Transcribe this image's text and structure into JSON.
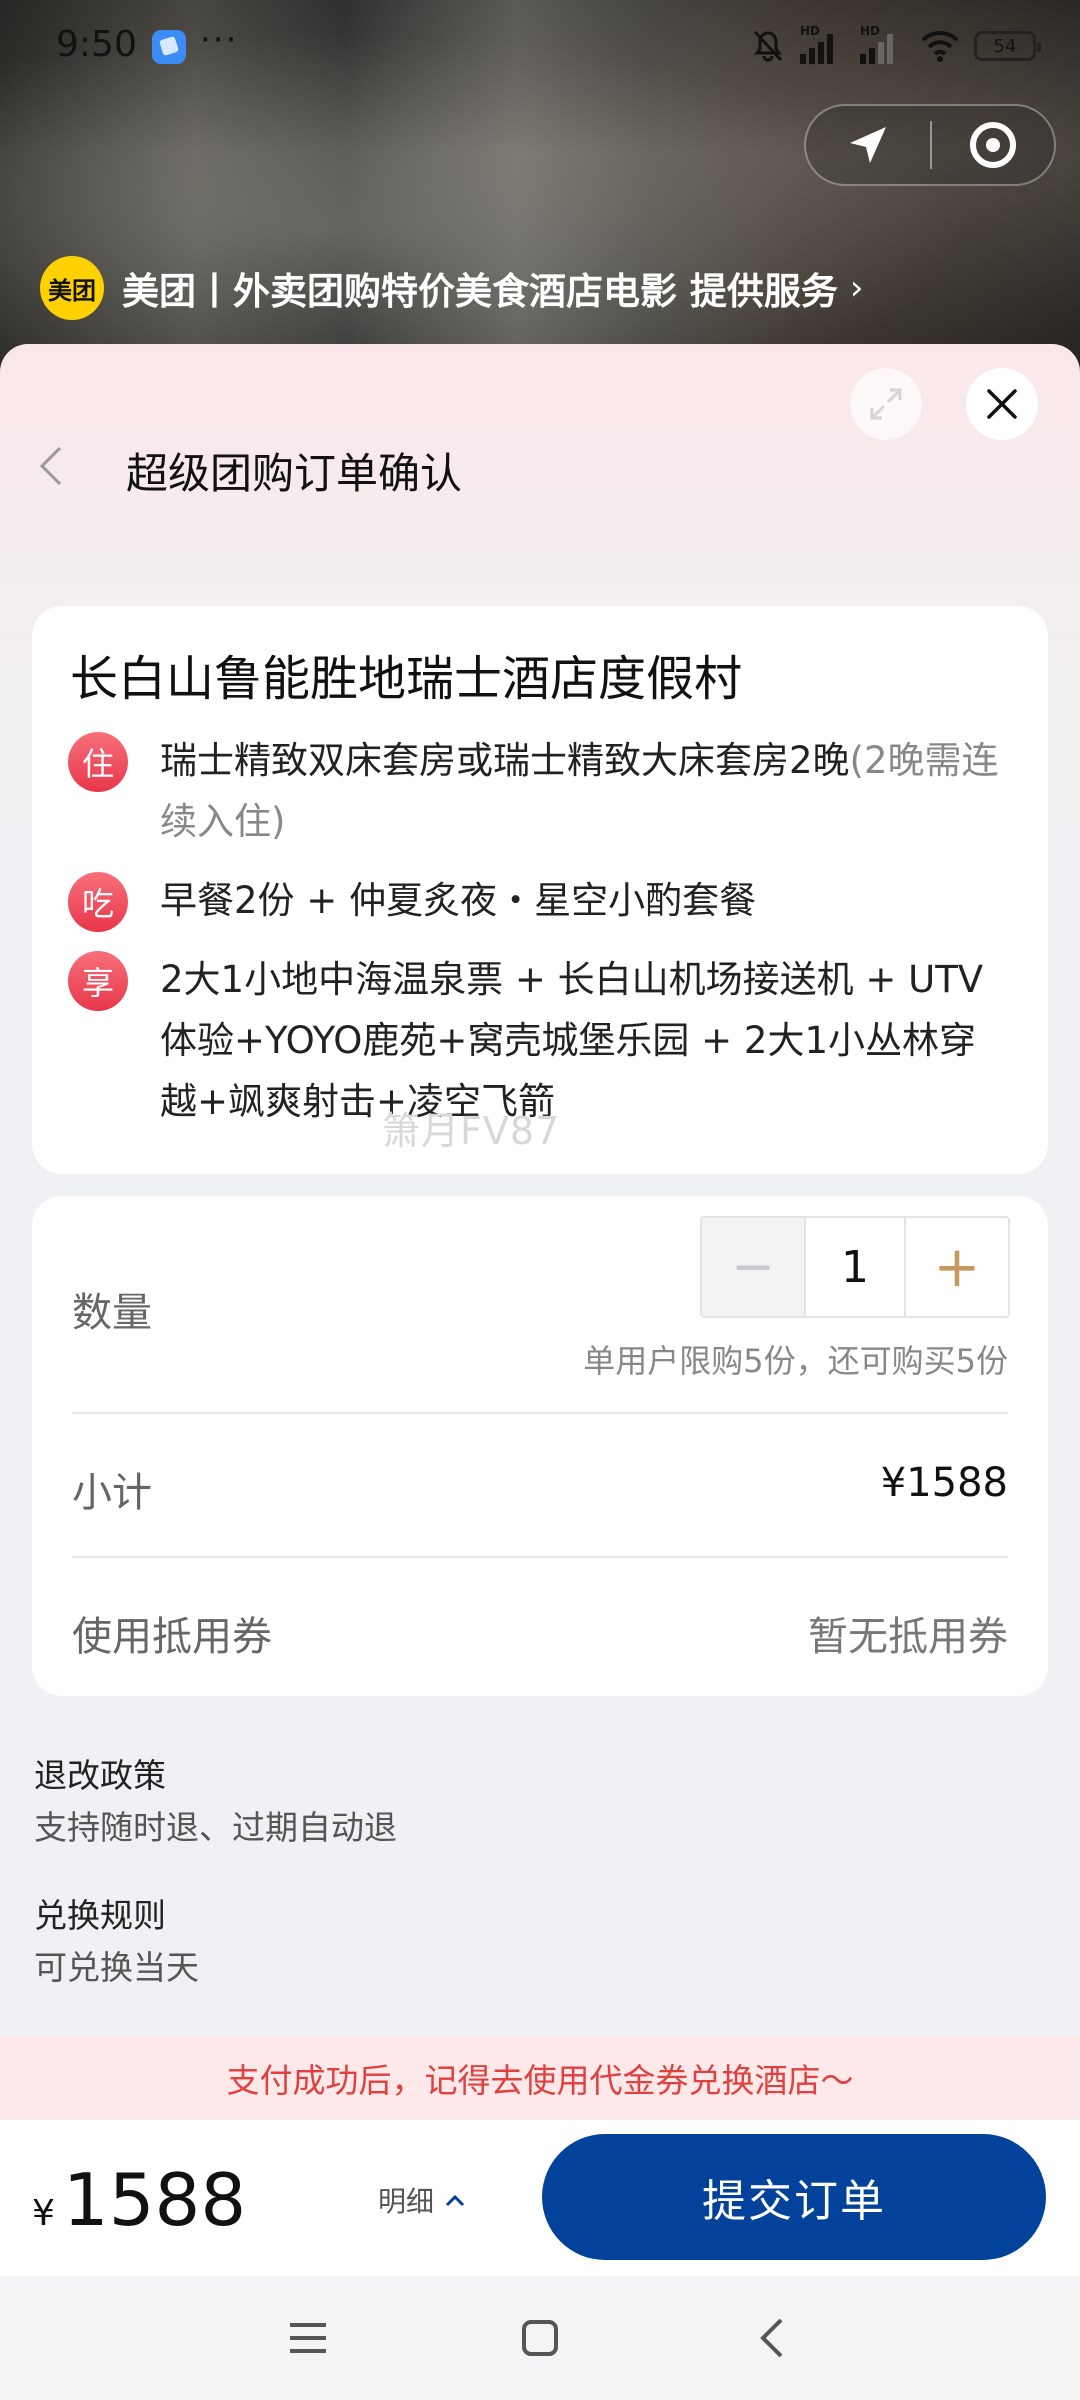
{
  "status_bar": {
    "time": "9:50",
    "dots": "···",
    "battery": "54",
    "hd": "HD"
  },
  "mini_program": {
    "provider_logo_text": "美团",
    "provider_text": "美团丨外卖团购特价美食酒店电影 提供服务",
    "provider_chevron": "›"
  },
  "header": {
    "title": "超级团购订单确认"
  },
  "product": {
    "hotel_name": "长白山鲁能胜地瑞士酒店度假村",
    "items": [
      {
        "badge": "住",
        "text": "瑞士精致双床套房或瑞士精致大床套房2晚",
        "note": "(2晚需连续入住)"
      },
      {
        "badge": "吃",
        "text": "早餐2份 + 仲夏炙夜・星空小酌套餐",
        "note": ""
      },
      {
        "badge": "享",
        "text": "2大1小地中海温泉票 + 长白山机场接送机 + UTV体验+YOYO鹿苑+窝壳城堡乐园 + 2大1小丛林穿越+飒爽射击+凌空飞箭",
        "note": ""
      }
    ],
    "watermark": "箫月FV87"
  },
  "order": {
    "quantity_label": "数量",
    "quantity_value": "1",
    "minus": "−",
    "plus": "+",
    "limit_note": "单用户限购5份，还可购买5份",
    "subtotal_label": "小计",
    "subtotal_value": "¥1588",
    "coupon_label": "使用抵用券",
    "coupon_value": "暂无抵用券"
  },
  "policies": {
    "refund_title": "退改政策",
    "refund_text": "支持随时退、过期自动退",
    "exchange_title": "兑换规则",
    "exchange_text": "可兑换当天"
  },
  "tip": "支付成功后，记得去使用代金券兑换酒店～",
  "footer": {
    "currency": "¥",
    "total": "1588",
    "detail_label": "明细",
    "submit_label": "提交订单"
  },
  "colors": {
    "accent_blue": "#03429b",
    "badge_red": "#e8374a",
    "tip_red": "#e0413f",
    "stepper_gold": "#c59a5e"
  }
}
